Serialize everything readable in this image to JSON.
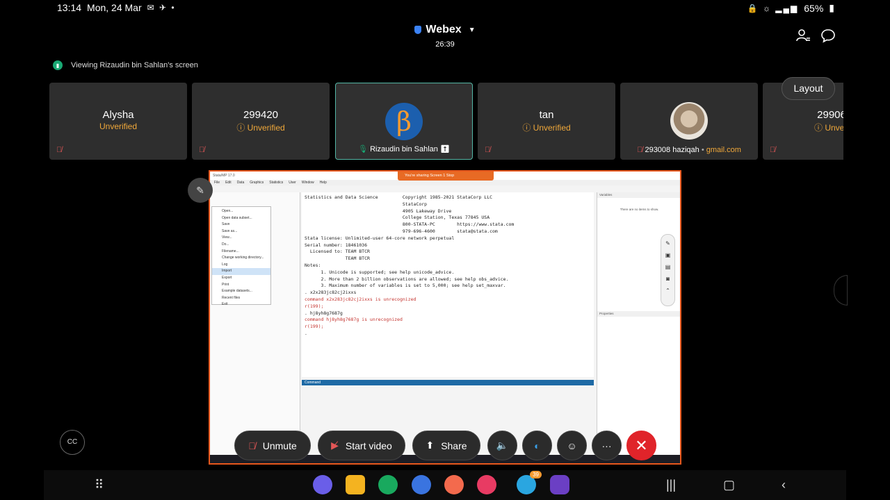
{
  "status_bar": {
    "time": "13:14",
    "date": "Mon, 24 Mar",
    "battery": "65%"
  },
  "header": {
    "app_name": "Webex",
    "timer": "26:39",
    "viewing_text": "Viewing Rizaudin bin Sahlan's screen"
  },
  "tiles": [
    {
      "name": "Alysha",
      "status": "Unverified"
    },
    {
      "name": "299420",
      "status": "Unverified"
    },
    {
      "name": "Rizaudin bin Sahlan",
      "status": ""
    },
    {
      "name": "tan",
      "status": "Unverified"
    },
    {
      "name": "293008 haziqah",
      "email_hint": "gmail.com"
    },
    {
      "name": "29906",
      "status": "Unveri"
    }
  ],
  "layout_button": "Layout",
  "shared_screen": {
    "app_title": "Stata/MP 17.0",
    "menu": [
      "File",
      "Edit",
      "Data",
      "Graphics",
      "Statistics",
      "User",
      "Window",
      "Help"
    ],
    "sharing_banner": "You're sharing Screen 1    Stop",
    "file_menu_items": [
      "Open...",
      "Open data subset...",
      "Save",
      "Save as...",
      "View...",
      "Do...",
      "Filename...",
      "Change working directory...",
      "Log",
      "Import",
      "Export",
      "Print",
      "Example datasets...",
      "Recent files",
      "Exit"
    ],
    "results_lines": [
      "Statistics and Data Science         Copyright 1985-2021 StataCorp LLC",
      "                                    StataCorp",
      "                                    4905 Lakeway Drive",
      "                                    College Station, Texas 77845 USA",
      "                                    800-STATA-PC        https://www.stata.com",
      "                                    979-696-4600        stata@stata.com",
      "",
      "Stata license: Unlimited-user 64-core network perpetual",
      "Serial number: 18461036",
      "  Licensed to: TEAM BTCR",
      "               TEAM BTCR",
      "",
      "Notes:",
      "      1. Unicode is supported; see help unicode_advice.",
      "      2. More than 2 billion observations are allowed; see help obs_advice.",
      "      3. Maximum number of variables is set to 5,000; see help set_maxvar.",
      "",
      ". x2x283jc82cj2ixxs",
      "command x2x283jc82cj2ixxs is unrecognized",
      "r(199);",
      "",
      ". hj8yh8g7687g",
      "command hj8yh8g7687g is unrecognized",
      "r(199);",
      "",
      "."
    ],
    "command_label": "Command",
    "variables_label": "Variables",
    "variables_empty": "There are no items to show.",
    "properties_label": "Properties"
  },
  "controls": {
    "unmute": "Unmute",
    "start_video": "Start video",
    "share": "Share",
    "more": "···"
  },
  "cc_label": "CC",
  "telegram_badge": "39"
}
